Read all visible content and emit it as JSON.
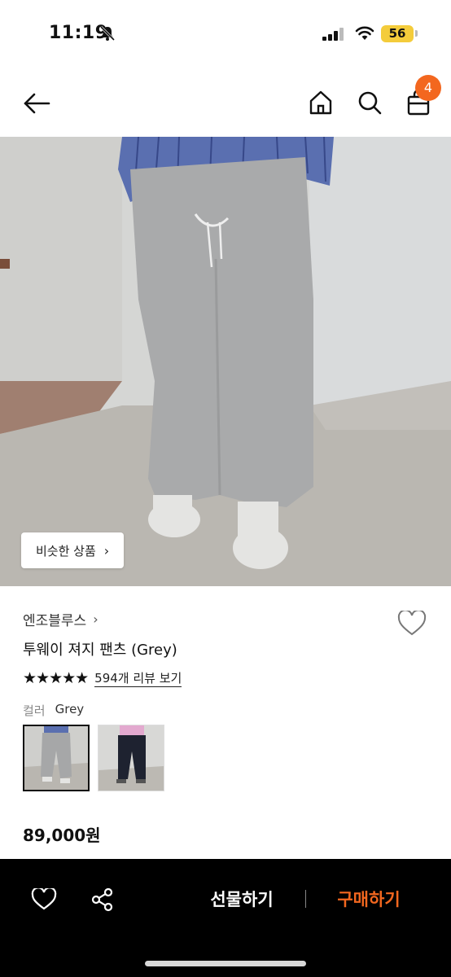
{
  "status_bar": {
    "time": "11:19",
    "battery": "56"
  },
  "header": {
    "cart_count": "4"
  },
  "hero": {
    "similar_button": "비슷한 상품",
    "similar_chevron": "›"
  },
  "product": {
    "brand": "엔조블루스",
    "brand_chevron": "›",
    "title": "투웨이 져지 팬츠 (Grey)",
    "rating_stars": "★★★★★",
    "reviews_link": "594개 리뷰 보기",
    "color_label": "컬러",
    "color_value": "Grey",
    "price": "89,000원"
  },
  "bottom_bar": {
    "gift_button": "선물하기",
    "buy_button": "구매하기"
  },
  "colors": {
    "accent": "#f3671f",
    "battery": "#f4cc3b",
    "bottom_bar_bg": "#000000"
  }
}
